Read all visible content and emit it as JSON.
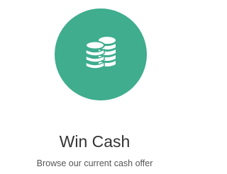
{
  "card": {
    "icon": "coins-icon",
    "accent_color": "#3fad8e",
    "title": "Win Cash",
    "subtitle": "Browse our current cash offer"
  }
}
